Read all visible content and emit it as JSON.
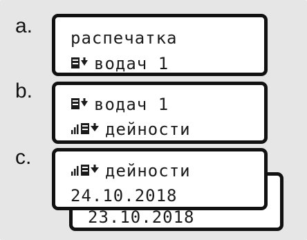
{
  "panels": [
    {
      "letter": "a.",
      "lines": [
        "распечатка",
        "водач 1"
      ]
    },
    {
      "letter": "b.",
      "lines": [
        "водач 1",
        "дейности"
      ]
    },
    {
      "letter": "c.",
      "lines": [
        "дейности",
        "24.10.2018"
      ],
      "back_date": "23.10.2018"
    }
  ],
  "icons": {
    "printer": "printer-icon",
    "activity": "activity-bars-icon"
  }
}
